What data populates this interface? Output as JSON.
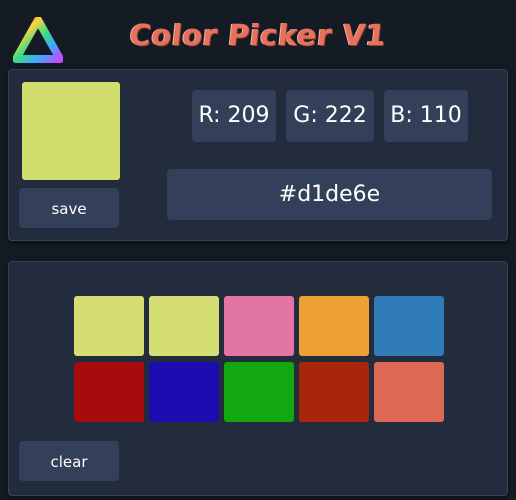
{
  "header": {
    "title": "Color Picker V1",
    "logo_icon": "rainbow-triangle-logo-icon"
  },
  "picker": {
    "current_color": "#d1de6e",
    "r_label": "R: 209",
    "g_label": "G: 222",
    "b_label": "B: 110",
    "hex": "#d1de6e",
    "save_label": "save"
  },
  "palette": {
    "swatches": [
      "#d4de72",
      "#d4de72",
      "#e274a6",
      "#eda132",
      "#2e7bb7",
      "#a70b0b",
      "#1d0caf",
      "#13a80f",
      "#a8260b",
      "#de6a56"
    ],
    "clear_label": "clear"
  }
}
